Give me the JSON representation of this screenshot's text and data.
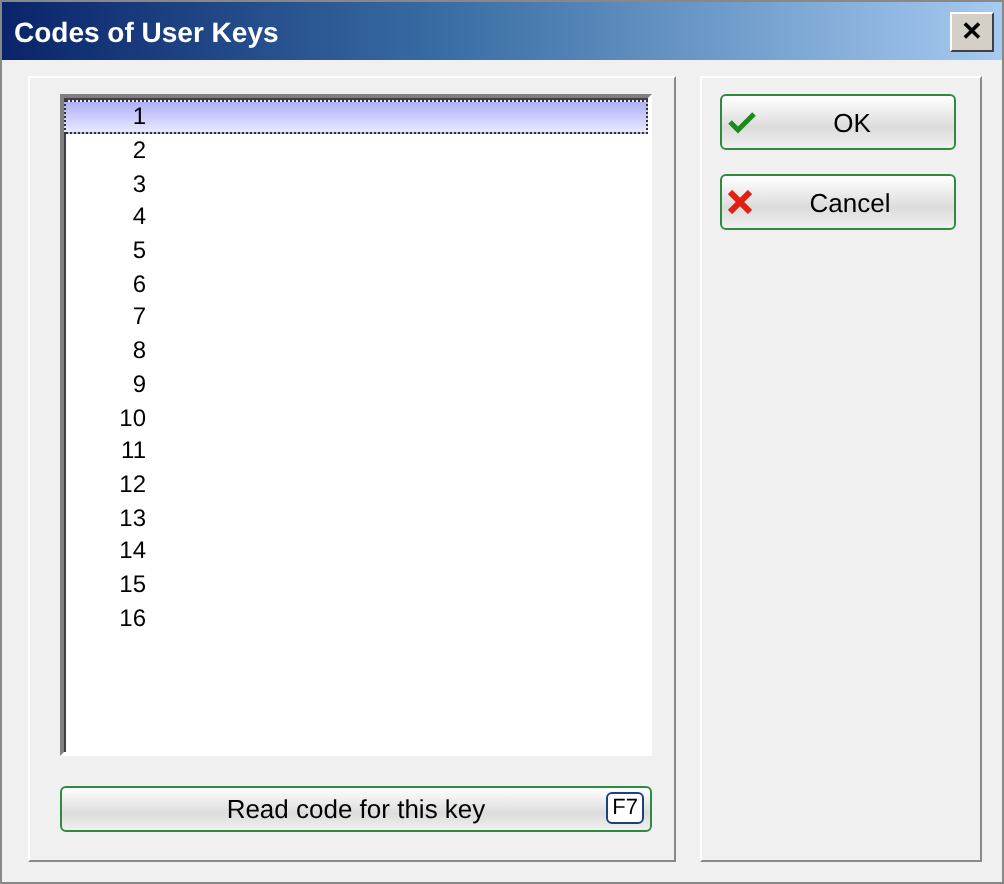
{
  "window": {
    "title": "Codes of User Keys",
    "close_glyph": "✕"
  },
  "keys": [
    {
      "label": "1",
      "selected": true
    },
    {
      "label": "2",
      "selected": false
    },
    {
      "label": "3",
      "selected": false
    },
    {
      "label": "4",
      "selected": false
    },
    {
      "label": "5",
      "selected": false
    },
    {
      "label": "6",
      "selected": false
    },
    {
      "label": "7",
      "selected": false
    },
    {
      "label": "8",
      "selected": false
    },
    {
      "label": "9",
      "selected": false
    },
    {
      "label": "10",
      "selected": false
    },
    {
      "label": "11",
      "selected": false
    },
    {
      "label": "12",
      "selected": false
    },
    {
      "label": "13",
      "selected": false
    },
    {
      "label": "14",
      "selected": false
    },
    {
      "label": "15",
      "selected": false
    },
    {
      "label": "16",
      "selected": false
    }
  ],
  "read_button": {
    "label": "Read code for this key",
    "shortcut": "F7"
  },
  "buttons": [
    {
      "kind": "ok",
      "label": "OK"
    },
    {
      "kind": "cancel",
      "label": "Cancel"
    }
  ]
}
